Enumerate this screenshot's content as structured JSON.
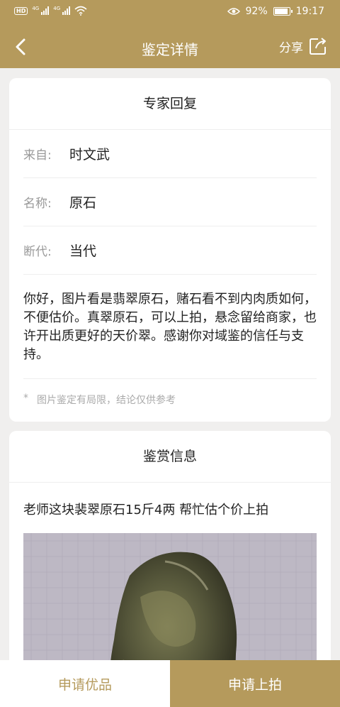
{
  "status_bar": {
    "hd": "HD",
    "net1": "4G",
    "net2": "4G",
    "battery": "92%",
    "time": "19:17"
  },
  "header": {
    "title": "鉴定详情",
    "share_label": "分享"
  },
  "expert_reply": {
    "heading": "专家回复",
    "fields": [
      {
        "label": "来自:",
        "value": "时文武"
      },
      {
        "label": "名称:",
        "value": "原石"
      },
      {
        "label": "断代:",
        "value": "当代"
      }
    ],
    "reply_text": "你好，图片看是翡翠原石，赌石看不到内肉质如何，不便估价。真翠原石，可以上拍，悬念留给商家，也许开出质更好的天价翠。感谢你对域鉴的信任与支持。",
    "note_mark": "*",
    "note": "图片鉴定有局限，结论仅供参考"
  },
  "appreciation": {
    "heading": "鉴赏信息",
    "description": "老师这块裴翠原石15斤4两  帮忙估个价上拍"
  },
  "actions": {
    "premium_label": "申请优品",
    "auction_label": "申请上拍"
  },
  "colors": {
    "brand": "#b59a5c",
    "background": "#f0efee"
  }
}
